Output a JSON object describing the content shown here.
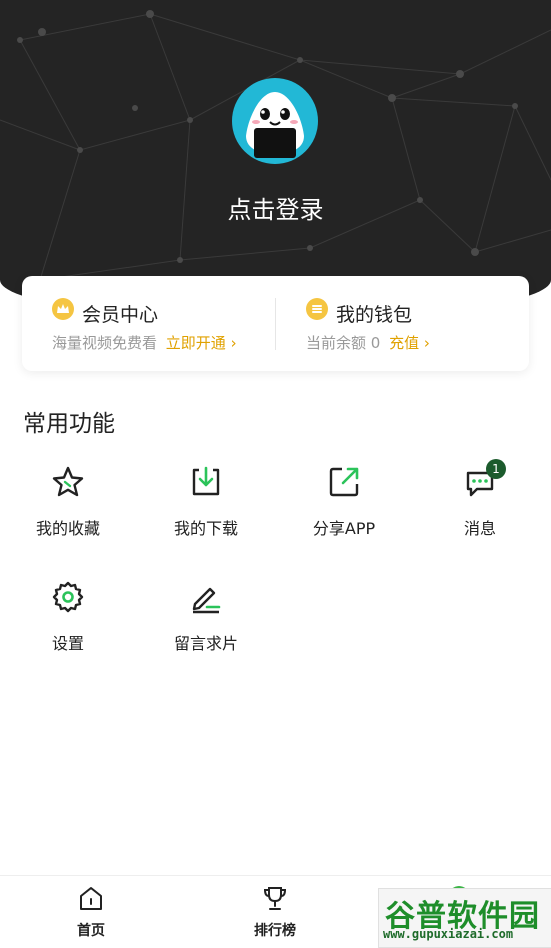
{
  "hero": {
    "login_text": "点击登录",
    "colors": {
      "background": "#242424",
      "avatar_ring": "#22b8d6"
    }
  },
  "membership": {
    "title": "会员中心",
    "subtitle": "海量视频免费看",
    "action": "立即开通 ›",
    "icon": "crown-icon",
    "accent": "#e0a100"
  },
  "wallet": {
    "title": "我的钱包",
    "balance_text": "当前余额 0",
    "action": "充值 ›",
    "icon": "coin-icon"
  },
  "functions": {
    "title": "常用功能",
    "items": [
      {
        "label": "我的收藏",
        "icon": "star-icon"
      },
      {
        "label": "我的下载",
        "icon": "download-icon"
      },
      {
        "label": "分享APP",
        "icon": "share-icon"
      },
      {
        "label": "消息",
        "icon": "message-icon",
        "badge": "1"
      },
      {
        "label": "设置",
        "icon": "gear-icon"
      },
      {
        "label": "留言求片",
        "icon": "edit-icon"
      }
    ],
    "accent": "#2bc35a"
  },
  "tabbar": {
    "items": [
      {
        "label": "首页",
        "icon": "home-icon"
      },
      {
        "label": "排行榜",
        "icon": "trophy-icon"
      }
    ],
    "dot_color": "#3cb447"
  },
  "watermark": {
    "title": "谷普软件园",
    "url": "www.gupuxiazai.com"
  }
}
